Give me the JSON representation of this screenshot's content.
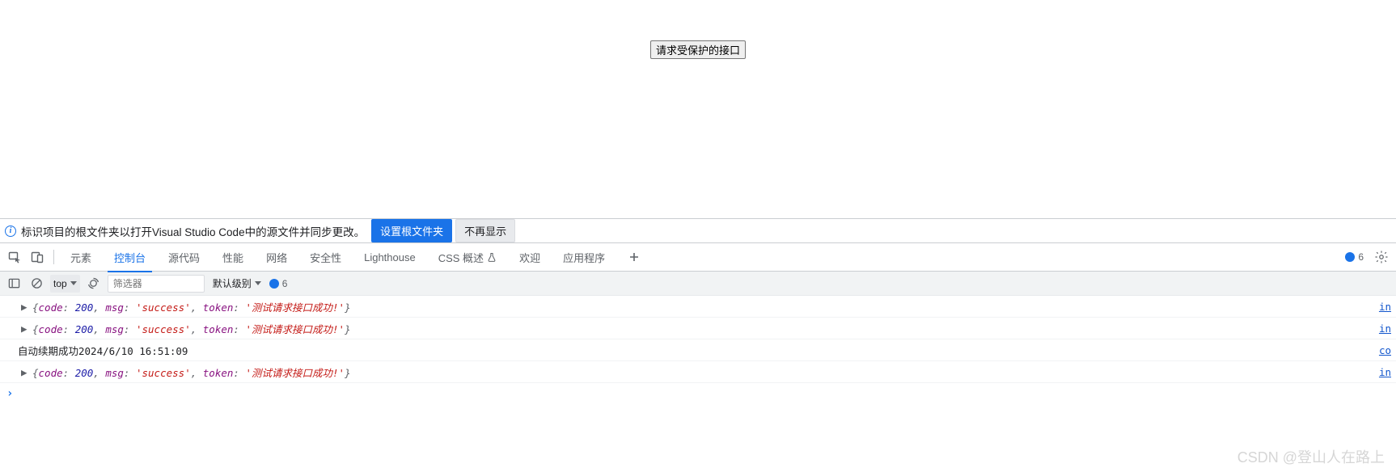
{
  "page": {
    "button_label": "请求受保护的接口"
  },
  "infobar": {
    "message": "标识项目的根文件夹以打开Visual Studio Code中的源文件并同步更改。",
    "primary_button": "设置根文件夹",
    "secondary_button": "不再显示"
  },
  "tabs": {
    "items": [
      {
        "label": "元素"
      },
      {
        "label": "控制台"
      },
      {
        "label": "源代码"
      },
      {
        "label": "性能"
      },
      {
        "label": "网络"
      },
      {
        "label": "安全性"
      },
      {
        "label": "Lighthouse"
      },
      {
        "label": "CSS 概述"
      },
      {
        "label": "欢迎"
      },
      {
        "label": "应用程序"
      }
    ],
    "active_index": 1,
    "info_badge_count": "6"
  },
  "console_toolbar": {
    "context": "top",
    "filter_placeholder": "筛选器",
    "level_label": "默认级别",
    "msg_count": "6"
  },
  "logs": [
    {
      "type": "object",
      "src": "in",
      "obj": {
        "code": "200",
        "msg": "'success'",
        "token": "'测试请求接口成功!'"
      }
    },
    {
      "type": "object",
      "src": "in",
      "obj": {
        "code": "200",
        "msg": "'success'",
        "token": "'测试请求接口成功!'"
      }
    },
    {
      "type": "plain",
      "src": "co",
      "text": "自动续期成功2024/6/10 16:51:09"
    },
    {
      "type": "object",
      "src": "in",
      "obj": {
        "code": "200",
        "msg": "'success'",
        "token": "'测试请求接口成功!'"
      }
    }
  ],
  "watermark": "CSDN @登山人在路上"
}
